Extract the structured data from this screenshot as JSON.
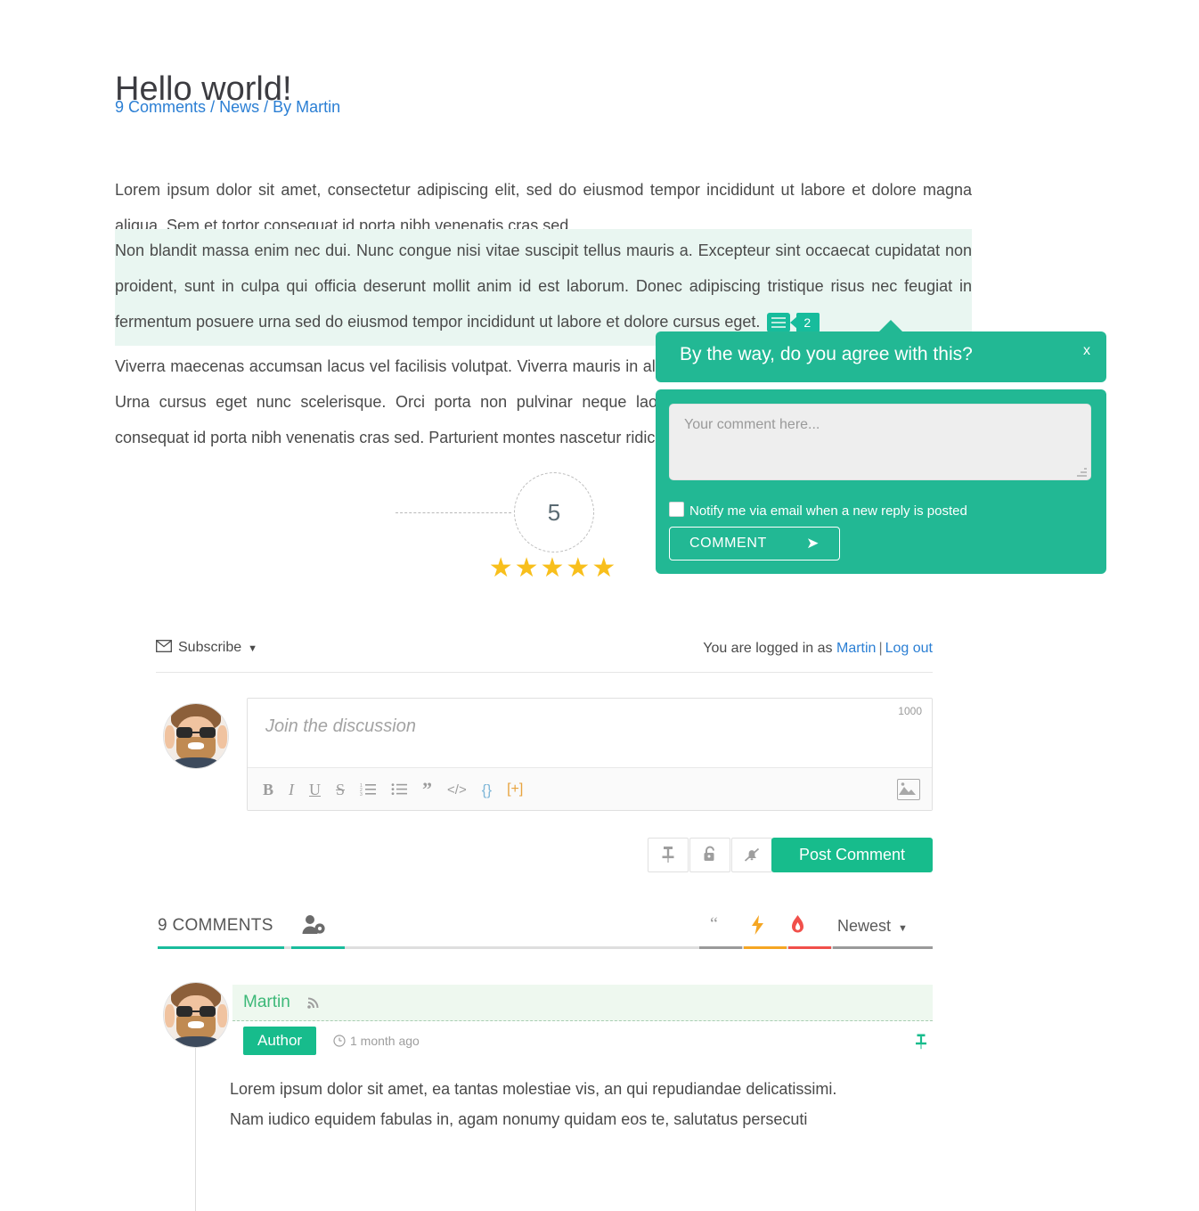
{
  "article": {
    "title": "Hello world!",
    "meta_comments": "9 Comments",
    "meta_sep1": "/",
    "meta_category": "News",
    "meta_sep2": "/",
    "meta_author": "By Martin",
    "paragraph1": "Lorem ipsum dolor sit amet, consectetur adipiscing elit, sed do eiusmod tempor incididunt ut labore et dolore magna aliqua.  Sem et tortor consequat id porta nibh venenatis cras sed.",
    "paragraph2": "Non blandit massa enim nec dui. Nunc congue nisi vitae suscipit tellus mauris a. Excepteur sint occaecat cupidatat non proident, sunt in culpa qui officia deserunt mollit anim id est laborum. Donec adipiscing tristique risus nec feugiat in fermentum posuere urna sed do eiusmod tempor incididunt ut labore et dolore cursus eget.",
    "paragraph3": "Viverra maecenas accumsan lacus vel facilisis volutpat. Viverra mauris in aliquam sem fringilla ut morbi tincidunt augue. Urna cursus eget nunc scelerisque. Orci porta non pulvinar neque laoreet suspendisse interdum. Sem et tortor consequat id porta nibh venenatis cras sed. Parturient montes nascetur ridiculus mus mauris.",
    "inline_marker_count": "2"
  },
  "rating": {
    "value": "5",
    "stars": "★★★★★"
  },
  "popup": {
    "question": "By the way, do you agree with this?",
    "close_label": "x",
    "textarea_placeholder": "Your comment here...",
    "textarea_value": "",
    "notify_label": "Notify me via email when a new reply is posted",
    "notify_checked": false,
    "submit_label": "COMMENT",
    "submit_icon": "➤",
    "accent_color": "#22b894"
  },
  "subscribe_bar": {
    "subscribe_label": "Subscribe",
    "logged_in_prefix": "You are logged in as",
    "user": "Martin",
    "divider": "|",
    "logout_label": "Log out"
  },
  "editor": {
    "placeholder": "Join the discussion",
    "value": "",
    "char_counter": "1000",
    "toolbar": [
      {
        "name": "bold",
        "label": "B"
      },
      {
        "name": "italic",
        "label": "I"
      },
      {
        "name": "underline",
        "label": "U"
      },
      {
        "name": "strike",
        "label": "S"
      },
      {
        "name": "ordered-list",
        "label": "≔"
      },
      {
        "name": "unordered-list",
        "label": "☰"
      },
      {
        "name": "blockquote",
        "label": "”"
      },
      {
        "name": "code",
        "label": "</>"
      },
      {
        "name": "source-code",
        "label": "{}"
      },
      {
        "name": "spoiler",
        "label": "[+]"
      }
    ]
  },
  "actions": {
    "pin_icon": "pin-icon",
    "lock_icon": "unlock-icon",
    "bell_icon": "bell-off-icon",
    "post_label": "Post Comment",
    "post_color": "#17bc8c"
  },
  "comments_header": {
    "count_label": "9 COMMENTS",
    "sort_label": "Newest",
    "icons": [
      {
        "name": "quote-icon",
        "color": "#9a9a9a"
      },
      {
        "name": "bolt-icon",
        "color": "#f5a623"
      },
      {
        "name": "flame-icon",
        "color": "#f1504b"
      }
    ]
  },
  "comment": {
    "author": "Martin",
    "badge": "Author",
    "time": "1 month ago",
    "body_line1": "Lorem ipsum dolor sit amet, ea tantas molestiae vis, an qui repudiandae delicatissimi.",
    "body_line2": "Nam iudico equidem fabulas in, agam nonumy quidam eos te, salutatus persecuti"
  }
}
